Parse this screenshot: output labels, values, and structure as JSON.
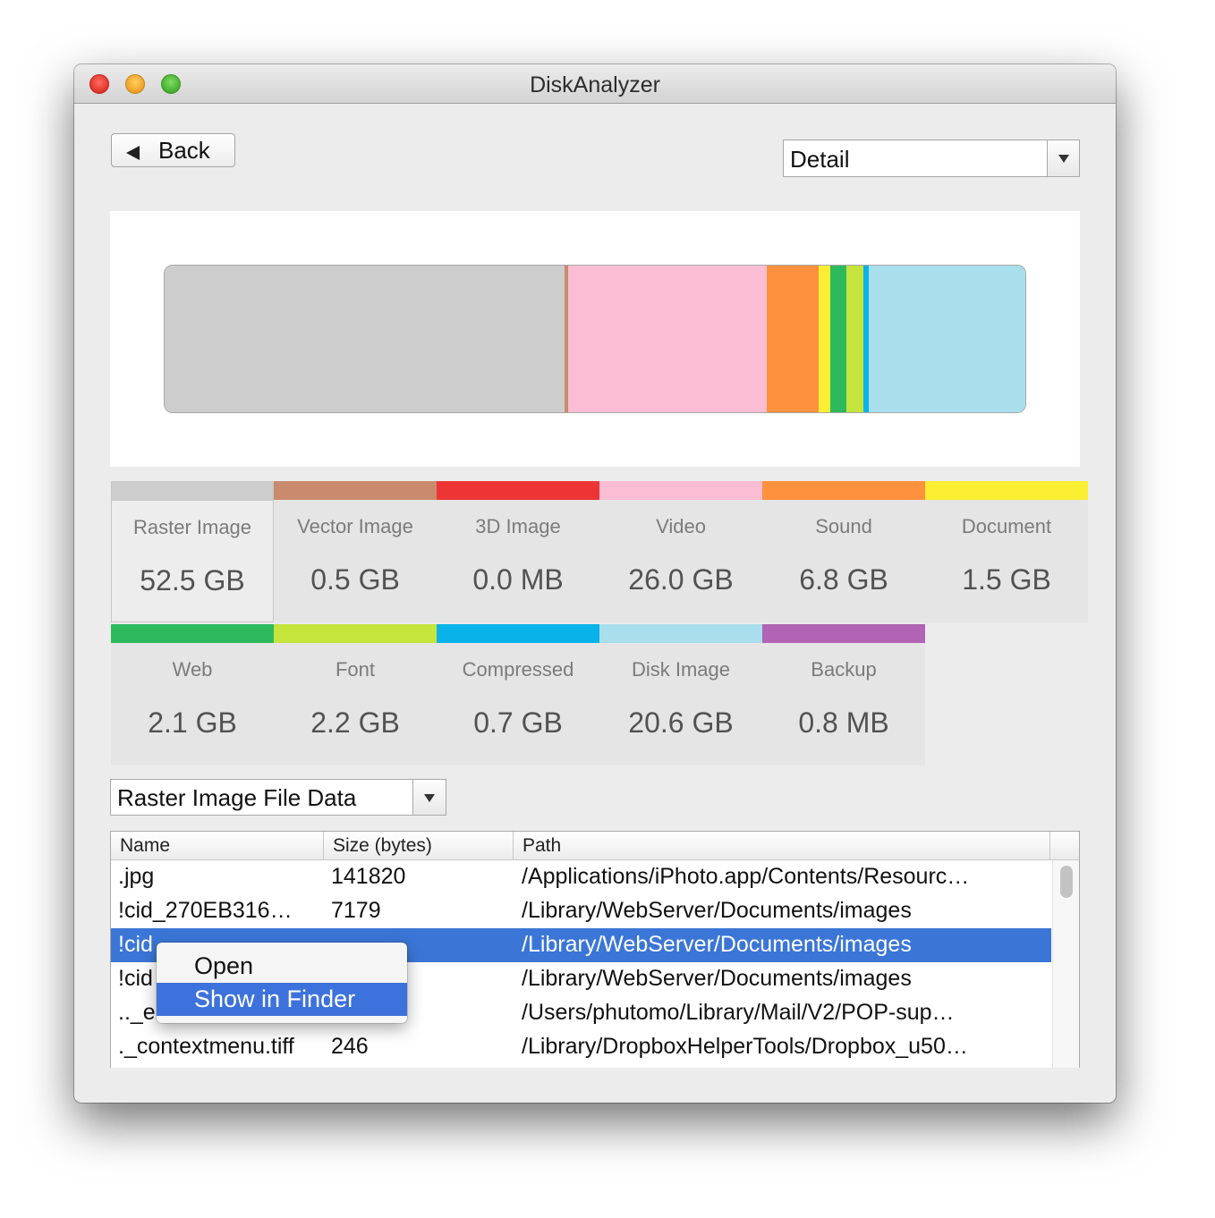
{
  "window": {
    "title": "DiskAnalyzer"
  },
  "toolbar": {
    "back_label": "Back",
    "view_mode": "Detail"
  },
  "colors": {
    "raster_image": "#cdcdcd",
    "vector_image": "#c98a6e",
    "3d_image": "#ee3536",
    "video": "#fbbdd4",
    "sound": "#fd913d",
    "document": "#fbee33",
    "web": "#2dba5d",
    "font": "#c5e43c",
    "compressed": "#09b3e9",
    "disk_image": "#a9deec",
    "backup": "#b064b3",
    "selection": "#3b76d7"
  },
  "usage_bar": {
    "segments": [
      {
        "category": "Raster Image",
        "value_gb": 52.5,
        "color": "#cdcdcd"
      },
      {
        "category": "Vector Image",
        "value_gb": 0.5,
        "color": "#c98a6e"
      },
      {
        "category": "3D Image",
        "value_gb": 0.0,
        "color": "#ee3536"
      },
      {
        "category": "Video",
        "value_gb": 26.0,
        "color": "#fbbdd4"
      },
      {
        "category": "Sound",
        "value_gb": 6.8,
        "color": "#fd913d"
      },
      {
        "category": "Document",
        "value_gb": 1.5,
        "color": "#fbee33"
      },
      {
        "category": "Web",
        "value_gb": 2.1,
        "color": "#2dba5d"
      },
      {
        "category": "Font",
        "value_gb": 2.2,
        "color": "#c5e43c"
      },
      {
        "category": "Compressed",
        "value_gb": 0.7,
        "color": "#09b3e9"
      },
      {
        "category": "Disk Image",
        "value_gb": 20.6,
        "color": "#a9deec"
      },
      {
        "category": "Backup",
        "value_gb": 0.0008,
        "color": "#b064b3"
      }
    ]
  },
  "categories": [
    {
      "name": "Raster Image",
      "size": "52.5 GB",
      "color": "#cdcdcd",
      "selected": true
    },
    {
      "name": "Vector Image",
      "size": "0.5 GB",
      "color": "#c98a6e"
    },
    {
      "name": "3D Image",
      "size": "0.0 MB",
      "color": "#ee3536"
    },
    {
      "name": "Video",
      "size": "26.0 GB",
      "color": "#fbbdd4"
    },
    {
      "name": "Sound",
      "size": "6.8 GB",
      "color": "#fd913d"
    },
    {
      "name": "Document",
      "size": "1.5 GB",
      "color": "#fbee33"
    },
    {
      "name": "Web",
      "size": "2.1 GB",
      "color": "#2dba5d"
    },
    {
      "name": "Font",
      "size": "2.2 GB",
      "color": "#c5e43c"
    },
    {
      "name": "Compressed",
      "size": "0.7 GB",
      "color": "#09b3e9"
    },
    {
      "name": "Disk Image",
      "size": "20.6 GB",
      "color": "#a9deec"
    },
    {
      "name": "Backup",
      "size": "0.8 MB",
      "color": "#b064b3"
    }
  ],
  "file_list": {
    "filter": "Raster Image File Data",
    "columns": [
      "Name",
      "Size (bytes)",
      "Path"
    ],
    "rows": [
      {
        "name": " .jpg",
        "size": "141820",
        "path": "/Applications/iPhoto.app/Contents/Resourc…"
      },
      {
        "name": "!cid_270EB316…",
        "size": "7179",
        "path": "/Library/WebServer/Documents/images"
      },
      {
        "name": "!cid",
        "size": "",
        "path": "/Library/WebServer/Documents/images",
        "selected": true
      },
      {
        "name": "!cid",
        "size": "",
        "path": "/Library/WebServer/Documents/images"
      },
      {
        "name": ".._e",
        "size": "",
        "path": "/Users/phutomo/Library/Mail/V2/POP-sup…"
      },
      {
        "name": "._contextmenu.tiff",
        "size": "246",
        "path": "/Library/DropboxHelperTools/Dropbox_u50…"
      }
    ]
  },
  "context_menu": {
    "items": [
      {
        "label": "Open",
        "highlighted": false
      },
      {
        "label": "Show in Finder",
        "highlighted": true
      }
    ]
  }
}
